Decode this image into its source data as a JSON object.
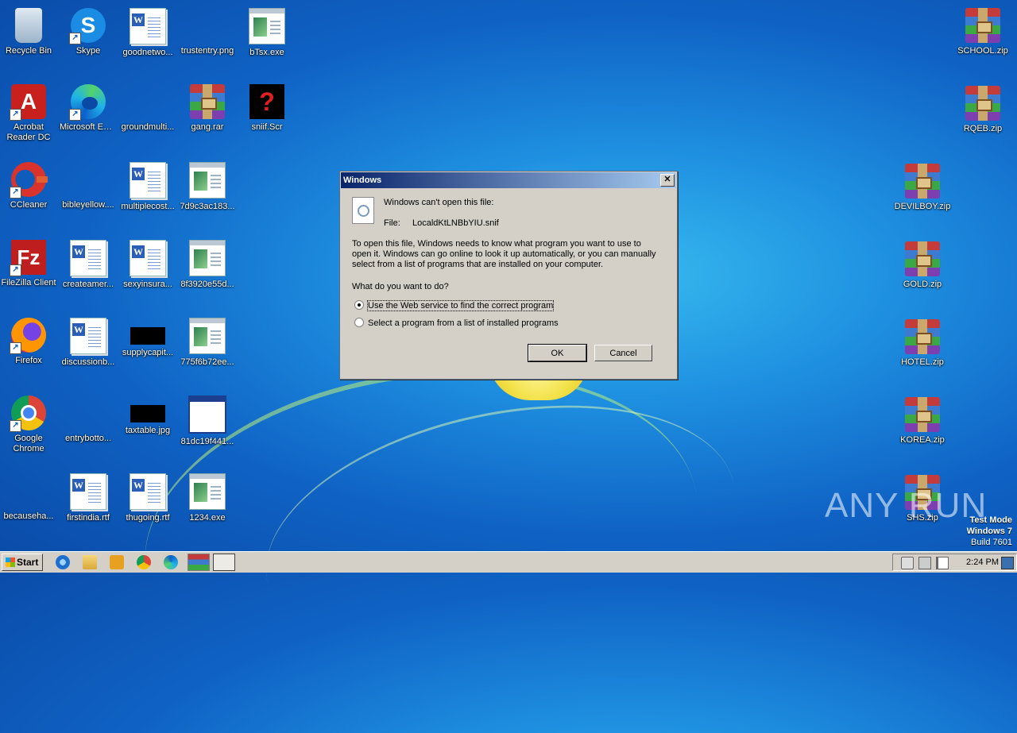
{
  "desktop": {
    "icons": [
      {
        "id": "recycle-bin",
        "label": "Recycle Bin",
        "shortcut": false
      },
      {
        "id": "skype",
        "label": "Skype",
        "shortcut": true
      },
      {
        "id": "goodnetwork",
        "label": "goodnetwo..."
      },
      {
        "id": "trustentry",
        "label": "trustentry.png"
      },
      {
        "id": "btsx",
        "label": "bTsx.exe"
      },
      {
        "id": "acrobat",
        "label": "Acrobat Reader DC",
        "shortcut": true
      },
      {
        "id": "edge",
        "label": "Microsoft Edge",
        "shortcut": true
      },
      {
        "id": "groundmulti",
        "label": "groundmulti..."
      },
      {
        "id": "gang",
        "label": "gang.rar"
      },
      {
        "id": "sniif",
        "label": "sniif.Scr"
      },
      {
        "id": "ccleaner",
        "label": "CCleaner",
        "shortcut": true
      },
      {
        "id": "bibleyellow",
        "label": "bibleyellow...."
      },
      {
        "id": "multiplecost",
        "label": "multiplecost..."
      },
      {
        "id": "7d9c3ac183",
        "label": "7d9c3ac183..."
      },
      {
        "id": "filezilla",
        "label": "FileZilla Client",
        "shortcut": true
      },
      {
        "id": "createamer",
        "label": "createamer..."
      },
      {
        "id": "sexyinsura",
        "label": "sexyinsura..."
      },
      {
        "id": "8f3920e55d",
        "label": "8f3920e55d..."
      },
      {
        "id": "firefox",
        "label": "Firefox",
        "shortcut": true
      },
      {
        "id": "discussionb",
        "label": "discussionb..."
      },
      {
        "id": "supplycapit",
        "label": "supplycapit..."
      },
      {
        "id": "775f6b72ee",
        "label": "775f6b72ee..."
      },
      {
        "id": "chrome",
        "label": "Google Chrome",
        "shortcut": true
      },
      {
        "id": "entrybotto",
        "label": "entrybotto..."
      },
      {
        "id": "taxtable",
        "label": "taxtable.jpg"
      },
      {
        "id": "81dc19f441",
        "label": "81dc19f441..."
      },
      {
        "id": "becauseha",
        "label": "becauseha..."
      },
      {
        "id": "firstindia",
        "label": "firstindia.rtf"
      },
      {
        "id": "thugoing",
        "label": "thugoing.rtf"
      },
      {
        "id": "1234",
        "label": "1234.exe"
      },
      {
        "id": "school",
        "label": "SCHOOL.zip"
      },
      {
        "id": "rqeb",
        "label": "RQEB.zip"
      },
      {
        "id": "devilboy",
        "label": "DEVILBOY.zip"
      },
      {
        "id": "gold",
        "label": "GOLD.zip"
      },
      {
        "id": "hotel",
        "label": "HOTEL.zip"
      },
      {
        "id": "korea",
        "label": "KOREA.zip"
      },
      {
        "id": "shs",
        "label": "SHS.zip"
      }
    ]
  },
  "watermark": "ANY RUN",
  "test_mode": {
    "line1": "Test Mode",
    "line2": "Windows 7",
    "line3": "Build 7601"
  },
  "dialog": {
    "title": "Windows",
    "close_glyph": "✕",
    "heading": "Windows can't open this file:",
    "file_label": "File:",
    "file_name": "LocaldKtLNBbYIU.snif",
    "description": "To open this file, Windows needs to know what program you want to use to open it. Windows can go online to look it up automatically, or you can manually select from a list of programs that are installed on your computer.",
    "question": "What do you want to do?",
    "option_web": "Use the Web service to find the correct program",
    "option_list": "Select a program from a list of installed programs",
    "selected_option": "web",
    "ok_label": "OK",
    "cancel_label": "Cancel"
  },
  "taskbar": {
    "start_label": "Start",
    "clock": "2:24 PM",
    "pinned": [
      "internet-explorer-icon",
      "explorer-icon",
      "media-player-icon",
      "chrome-icon",
      "edge-icon",
      "winrar-icon",
      "notepad-icon"
    ]
  }
}
